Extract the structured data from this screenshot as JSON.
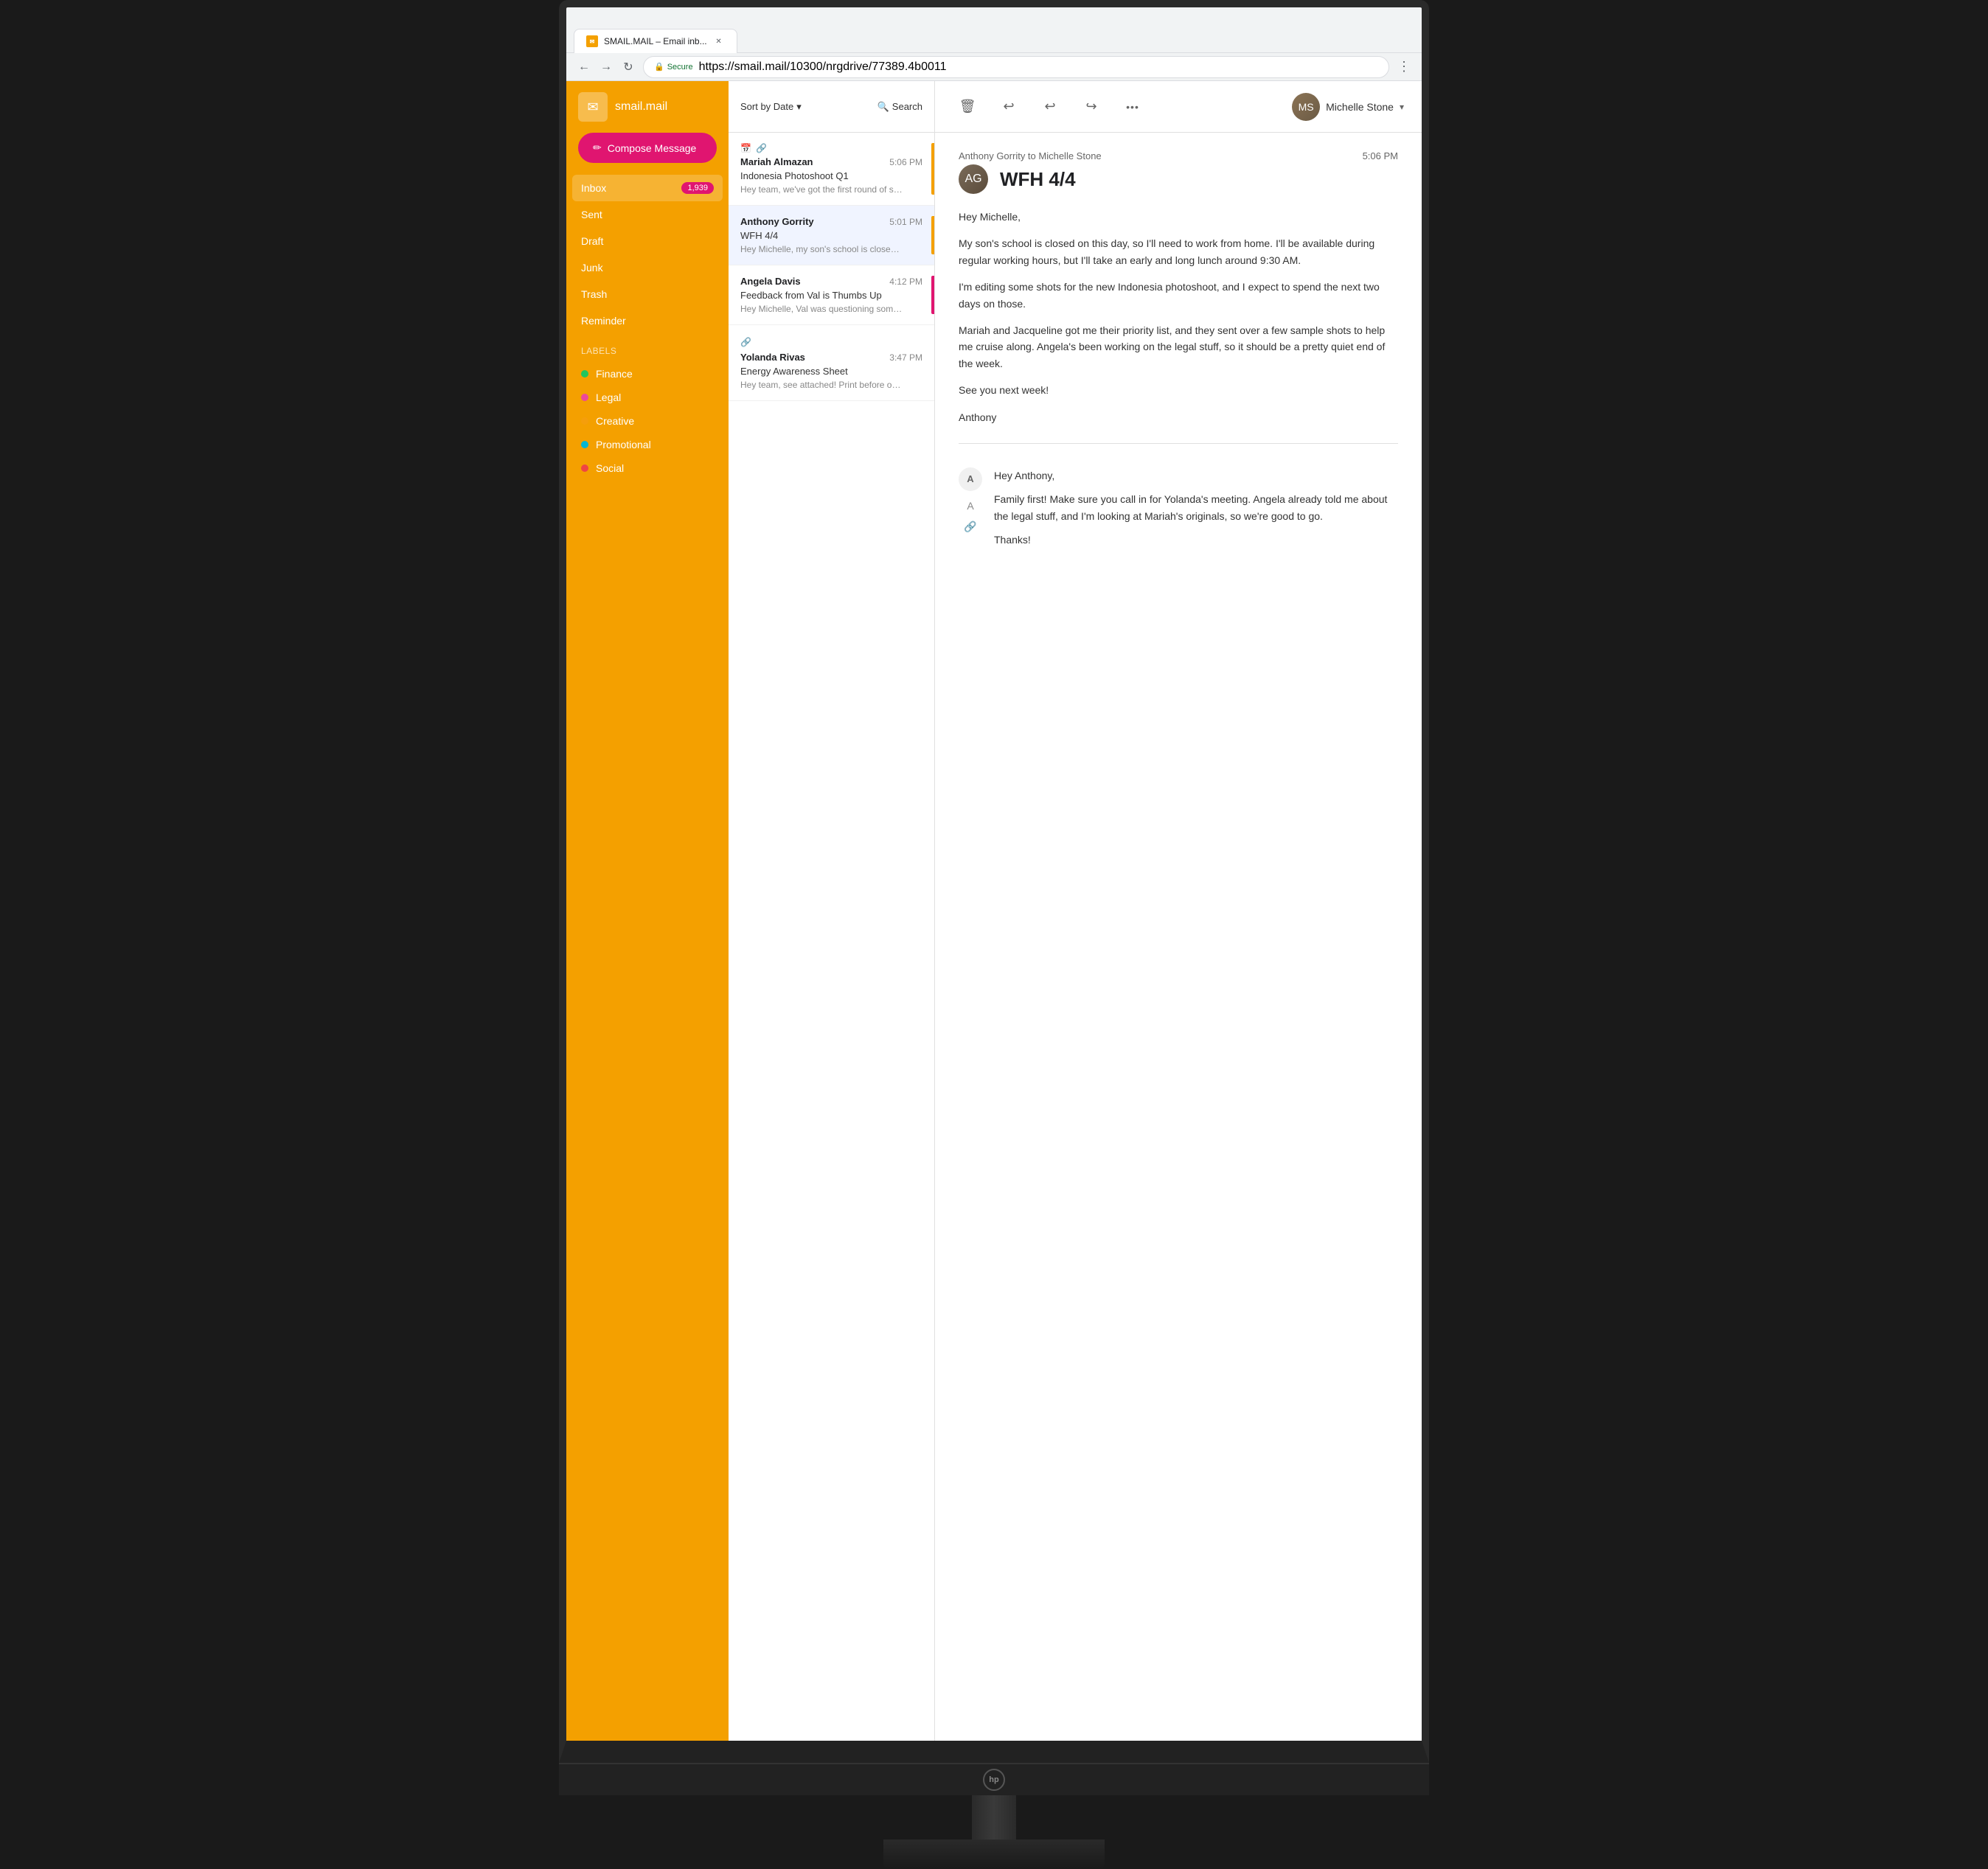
{
  "browser": {
    "tab_title": "SMAIL.MAIL – Email inb...",
    "url": "https://smail.mail/10300/nrgdrive/77389.4b0011",
    "secure_label": "Secure"
  },
  "app": {
    "logo_text": "smail.mail"
  },
  "compose": {
    "button_label": "Compose Message"
  },
  "nav": {
    "items": [
      {
        "label": "Inbox",
        "badge": "1,939"
      },
      {
        "label": "Sent",
        "badge": ""
      },
      {
        "label": "Draft",
        "badge": ""
      },
      {
        "label": "Junk",
        "badge": ""
      },
      {
        "label": "Trash",
        "badge": ""
      },
      {
        "label": "Reminder",
        "badge": ""
      }
    ]
  },
  "labels": {
    "title": "Labels",
    "items": [
      {
        "label": "Finance",
        "color": "#22c55e"
      },
      {
        "label": "Legal",
        "color": "#ec4899"
      },
      {
        "label": "Creative",
        "color": "#f59e0b"
      },
      {
        "label": "Promotional",
        "color": "#06b6d4"
      },
      {
        "label": "Social",
        "color": "#ef4444"
      }
    ]
  },
  "email_list": {
    "sort_label": "Sort by Date",
    "sort_icon": "▾",
    "search_label": "Search",
    "emails": [
      {
        "sender": "Mariah Almazan",
        "subject": "Indonesia Photoshoot Q1",
        "preview": "Hey team, we've got the first round of shots for you to check out. Please let me know your...",
        "time": "5:06 PM",
        "priority_color": "#f4a000",
        "has_calendar": true,
        "has_link": true
      },
      {
        "sender": "Anthony Gorrity",
        "subject": "WFH 4/4",
        "preview": "Hey Michelle, my son's school is closed on this day, so I'll need to work from home. I'll be available...",
        "time": "5:01 PM",
        "priority_color": "#f4a000",
        "has_calendar": false,
        "has_link": false
      },
      {
        "sender": "Angela Davis",
        "subject": "Feedback from Val is Thumbs Up",
        "preview": "Hey Michelle, Val was questioning some of the shots, but we got her the most recent metadata, and she said...",
        "time": "4:12 PM",
        "priority_color": "#e01570",
        "has_calendar": false,
        "has_link": false
      },
      {
        "sender": "Yolanda Rivas",
        "subject": "Energy Awareness Sheet",
        "preview": "Hey team, see attached! Print before our meeting this afternoon.",
        "time": "3:47 PM",
        "priority_color": "",
        "has_calendar": false,
        "has_link": true
      }
    ]
  },
  "email_view": {
    "from_to": "Anthony Gorrity to Michelle Stone",
    "time": "5:06 PM",
    "subject": "WFH 4/4",
    "body_paragraphs": [
      "Hey Michelle,",
      "My son's school is closed on this day, so I'll need to work from home. I'll be available during regular working hours, but I'll take an early and long lunch around 9:30 AM.",
      "I'm editing some shots for the new Indonesia photoshoot, and I expect to spend the next two days on those.",
      "Mariah and Jacqueline got me their priority list, and they sent over a few sample shots to help me cruise along. Angela's been working on the legal stuff, so it should be a pretty quiet end of the week.",
      "See you next week!",
      "Anthony"
    ],
    "reply": {
      "sender_initial": "A",
      "body_paragraphs": [
        "Hey Anthony,",
        "Family first! Make sure you call in for Yolanda's meeting. Angela already told me about the legal stuff, and I'm looking at Mariah's originals, so we're good to go.",
        "Thanks!"
      ]
    }
  },
  "toolbar": {
    "delete_icon": "🗑",
    "reply_icon": "↩",
    "reply_all_icon": "↩",
    "forward_icon": "↪",
    "more_icon": "•••"
  },
  "user": {
    "name": "Michelle Stone"
  }
}
